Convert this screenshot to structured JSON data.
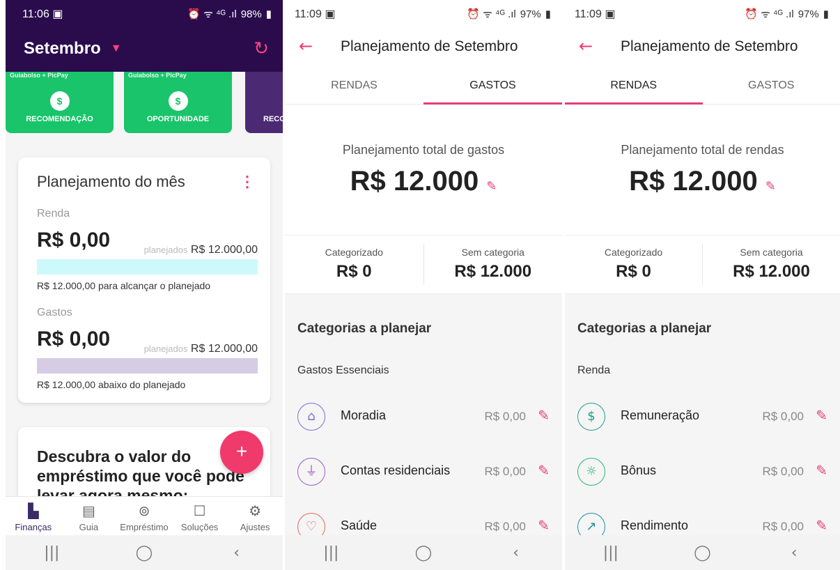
{
  "screen1": {
    "status": {
      "time": "11:06",
      "battery": "98%",
      "icons": "⏰ ᯤ ⁴ᴳ .ıl"
    },
    "month": "Setembro",
    "promos": [
      {
        "brand": "Guiabolso + PicPay",
        "label": "RECOMENDAÇÃO"
      },
      {
        "brand": "Guiabolso + PicPay",
        "label": "OPORTUNIDADE"
      },
      {
        "brand": "",
        "label": "RECO"
      }
    ],
    "plan": {
      "title": "Planejamento do mês",
      "income_label": "Renda",
      "income_value": "R$ 0,00",
      "income_planned_word": "planejados",
      "income_planned": "R$ 12.000,00",
      "income_note_amount": "R$ 12.000,00",
      "income_note": "para alcançar o planejado",
      "expense_label": "Gastos",
      "expense_value": "R$ 0,00",
      "expense_planned_word": "planejados",
      "expense_planned": "R$ 12.000,00",
      "expense_note_amount": "R$ 12.000,00",
      "expense_note": "abaixo do planejado"
    },
    "discover": "Descubra o valor do empréstimo que você pode levar agora mesmo:",
    "fab": "+",
    "tabs": [
      {
        "label": "Finanças",
        "icon": "📊"
      },
      {
        "label": "Guia",
        "icon": "▤"
      },
      {
        "label": "Empréstimo",
        "icon": "💰"
      },
      {
        "label": "Soluções",
        "icon": "☐"
      },
      {
        "label": "Ajustes",
        "icon": "⚙"
      }
    ],
    "colors": {
      "header": "#2a0c4d",
      "green": "#19c46b",
      "accent": "#e63d74",
      "income_bar": "#cdf9fb",
      "expense_bar": "#d6cce3"
    }
  },
  "screen2": {
    "status": {
      "time": "11:09",
      "battery": "97%",
      "icons": "⏰ ᯤ ⁴ᴳ .ıl"
    },
    "title": "Planejamento de Setembro",
    "tabs": [
      "RENDAS",
      "GASTOS"
    ],
    "selected_tab": "GASTOS",
    "total_caption": "Planejamento total de gastos",
    "total": "R$ 12.000",
    "categorized_label": "Categorizado",
    "categorized_value": "R$ 0",
    "uncategorized_label": "Sem categoria",
    "uncategorized_value": "R$ 12.000",
    "section_title": "Categorias a planejar",
    "group": "Gastos Essenciais",
    "rows": [
      {
        "name": "Moradia",
        "value": "R$ 0,00",
        "icon": "house-icon"
      },
      {
        "name": "Contas residenciais",
        "value": "R$ 0,00",
        "icon": "plug-icon"
      },
      {
        "name": "Saúde",
        "value": "R$ 0,00",
        "icon": "heart-icon"
      }
    ]
  },
  "screen3": {
    "status": {
      "time": "11:09",
      "battery": "97%",
      "icons": "⏰ ᯤ ⁴ᴳ .ıl"
    },
    "title": "Planejamento de Setembro",
    "tabs": [
      "RENDAS",
      "GASTOS"
    ],
    "selected_tab": "RENDAS",
    "total_caption": "Planejamento total de rendas",
    "total": "R$ 12.000",
    "categorized_label": "Categorizado",
    "categorized_value": "R$ 0",
    "uncategorized_label": "Sem categoria",
    "uncategorized_value": "R$ 12.000",
    "section_title": "Categorias a planejar",
    "group": "Renda",
    "rows": [
      {
        "name": "Remuneração",
        "value": "R$ 0,00",
        "icon": "salary-icon"
      },
      {
        "name": "Bônus",
        "value": "R$ 0,00",
        "icon": "bonus-icon"
      },
      {
        "name": "Rendimento",
        "value": "R$ 0,00",
        "icon": "chart-icon"
      }
    ]
  },
  "android_nav": {
    "recents": "|||",
    "home": "◯",
    "back": "‹"
  }
}
